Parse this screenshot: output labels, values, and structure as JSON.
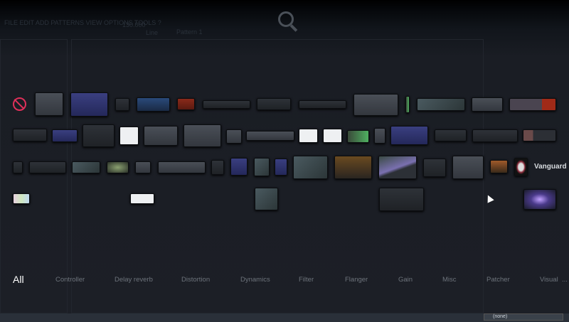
{
  "background": {
    "menu": "FILE EDIT ADD PATTERNS VIEW OPTIONS TOOLS ?",
    "tempo": "130.000",
    "pattern": "Pattern 1",
    "snap": "Line",
    "channel_target": "(none)"
  },
  "plugin_grid": {
    "named_plugin": "Vanguard"
  },
  "tabs": [
    {
      "label": "All",
      "active": true
    },
    {
      "label": "Controller"
    },
    {
      "label": "Delay reverb"
    },
    {
      "label": "Distortion"
    },
    {
      "label": "Dynamics"
    },
    {
      "label": "Filter"
    },
    {
      "label": "Flanger"
    },
    {
      "label": "Gain"
    },
    {
      "label": "Misc"
    },
    {
      "label": "Patcher"
    },
    {
      "label": "Visual"
    }
  ],
  "more_label": "...",
  "colors": {
    "accent_none": "#e0305a",
    "overlay": "#1c1f26"
  }
}
